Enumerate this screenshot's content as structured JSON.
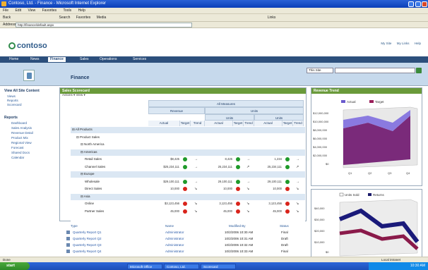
{
  "window": {
    "title": "Contoso, Ltd. - Finance - Microsoft Internet Explorer"
  },
  "menu": [
    "File",
    "Edit",
    "View",
    "Favorites",
    "Tools",
    "Help"
  ],
  "toolbar": [
    "Back",
    "Search",
    "Favorites",
    "Media",
    "Links"
  ],
  "address": {
    "label": "Address",
    "value": "http://finance/default.aspx"
  },
  "brand": {
    "name": "contoso"
  },
  "toplinks": [
    "My Site",
    "My Links",
    "Help"
  ],
  "nav": [
    "Home",
    "News",
    "Finance",
    "Sales",
    "Operations",
    "Services"
  ],
  "site": {
    "title": "Finance"
  },
  "search": {
    "scope": "This Site",
    "placeholder": ""
  },
  "leftnav": {
    "header1": "View All Site Content",
    "items1": [
      "Views",
      "Reports",
      "Scorecard"
    ],
    "header2": "Reports",
    "items2": [
      "Dashboard",
      "Sales Analysis",
      "Revenue Detail",
      "Product Mix",
      "Regional View",
      "Forecast",
      "Shared Docs",
      "Calendar"
    ]
  },
  "scorecard": {
    "title": "Sales Scorecard",
    "toolbar": "Actions ▾  View ▾",
    "groupHeader": "All Measures",
    "measures": [
      "Revenue",
      "Units"
    ],
    "subHeaders": [
      "Actual",
      "Target",
      "Trend"
    ],
    "rows": [
      {
        "label": "All Products",
        "level": 0,
        "band": true
      },
      {
        "label": "Product Sales",
        "level": 1,
        "band": false
      },
      {
        "label": "North America",
        "level": 2,
        "band": false
      },
      {
        "label": "Americas",
        "level": 2,
        "band": true
      },
      {
        "label": "Retail Sales",
        "level": 3,
        "a1": "$8,425",
        "s1": "g",
        "t1": "→",
        "a2": "8,425",
        "s2": "g",
        "t2": "→",
        "a3": "1,234",
        "s3": "g",
        "t3": "→"
      },
      {
        "label": "Channel Sales",
        "level": 3,
        "a1": "$25,234,111",
        "s1": "g",
        "t1": "→",
        "a2": "25,234,111",
        "s2": "g",
        "t2": "↗",
        "a3": "25,234,111",
        "s3": "g",
        "t3": "↗"
      },
      {
        "label": "Europe",
        "level": 2,
        "band": true
      },
      {
        "label": "Wholesale",
        "level": 3,
        "a1": "$29,100,111",
        "s1": "g",
        "t1": "→",
        "a2": "29,100,111",
        "s2": "g",
        "t2": "→",
        "a3": "29,100,111",
        "s3": "g",
        "t3": "→"
      },
      {
        "label": "Direct Sales",
        "level": 3,
        "a1": "10,000",
        "s1": "r",
        "t1": "↘",
        "a2": "10,000",
        "s2": "r",
        "t2": "↘",
        "a3": "10,000",
        "s3": "r",
        "t3": "↘"
      },
      {
        "label": "Asia",
        "level": 2,
        "band": true
      },
      {
        "label": "Online",
        "level": 3,
        "a1": "$3,123,456",
        "s1": "r",
        "t1": "↘",
        "a2": "3,123,456",
        "s2": "r",
        "t2": "↘",
        "a3": "3,123,456",
        "s3": "r",
        "t3": "↘"
      },
      {
        "label": "Partner Sales",
        "level": 3,
        "a1": "45,000",
        "s1": "r",
        "t1": "↘",
        "a2": "45,000",
        "s2": "r",
        "t2": "↘",
        "a3": "45,000",
        "s3": "r",
        "t3": "↘"
      }
    ]
  },
  "documents": {
    "headers": [
      "Type",
      "Name",
      "Modified By",
      "Modified",
      "Status"
    ],
    "rows": [
      {
        "name": "Quarterly Report Q1",
        "by": "Administrator",
        "date": "10/2/2006 10:30 AM",
        "status": "Final"
      },
      {
        "name": "Quarterly Report Q2",
        "by": "Administrator",
        "date": "10/2/2006 10:31 AM",
        "status": "Draft"
      },
      {
        "name": "Quarterly Report Q3",
        "by": "Administrator",
        "date": "10/2/2006 10:32 AM",
        "status": "Draft"
      },
      {
        "name": "Quarterly Report Q4",
        "by": "Administrator",
        "date": "10/2/2006 10:33 AM",
        "status": "Final"
      }
    ]
  },
  "chart1": {
    "title": "Revenue Trend",
    "legend": [
      "Actual",
      "Target"
    ],
    "ticks": [
      "$12,000,000",
      "$10,000,000",
      "$8,000,000",
      "$6,000,000",
      "$4,000,000",
      "$2,000,000",
      "$0"
    ],
    "xlabels": [
      "Q1",
      "Q2",
      "Q3",
      "Q4"
    ]
  },
  "chart2": {
    "title": "Units Trend",
    "legend": [
      "Units Sold",
      "Returns"
    ],
    "ticks": [
      "$40,000",
      "$30,000",
      "$20,000",
      "$10,000",
      "$0"
    ]
  },
  "status": {
    "left": "Done",
    "zone": "Local intranet"
  },
  "taskbar": {
    "start": "start",
    "tasks": [
      "Microsoft Office",
      "Contoso, Ltd.",
      "Scorecard"
    ],
    "clock": "10:30 AM"
  },
  "colors": {
    "nav": "#2c4f7c",
    "header": "#6a9a3a",
    "good": "#1f9a2a",
    "bad": "#d9241b"
  }
}
